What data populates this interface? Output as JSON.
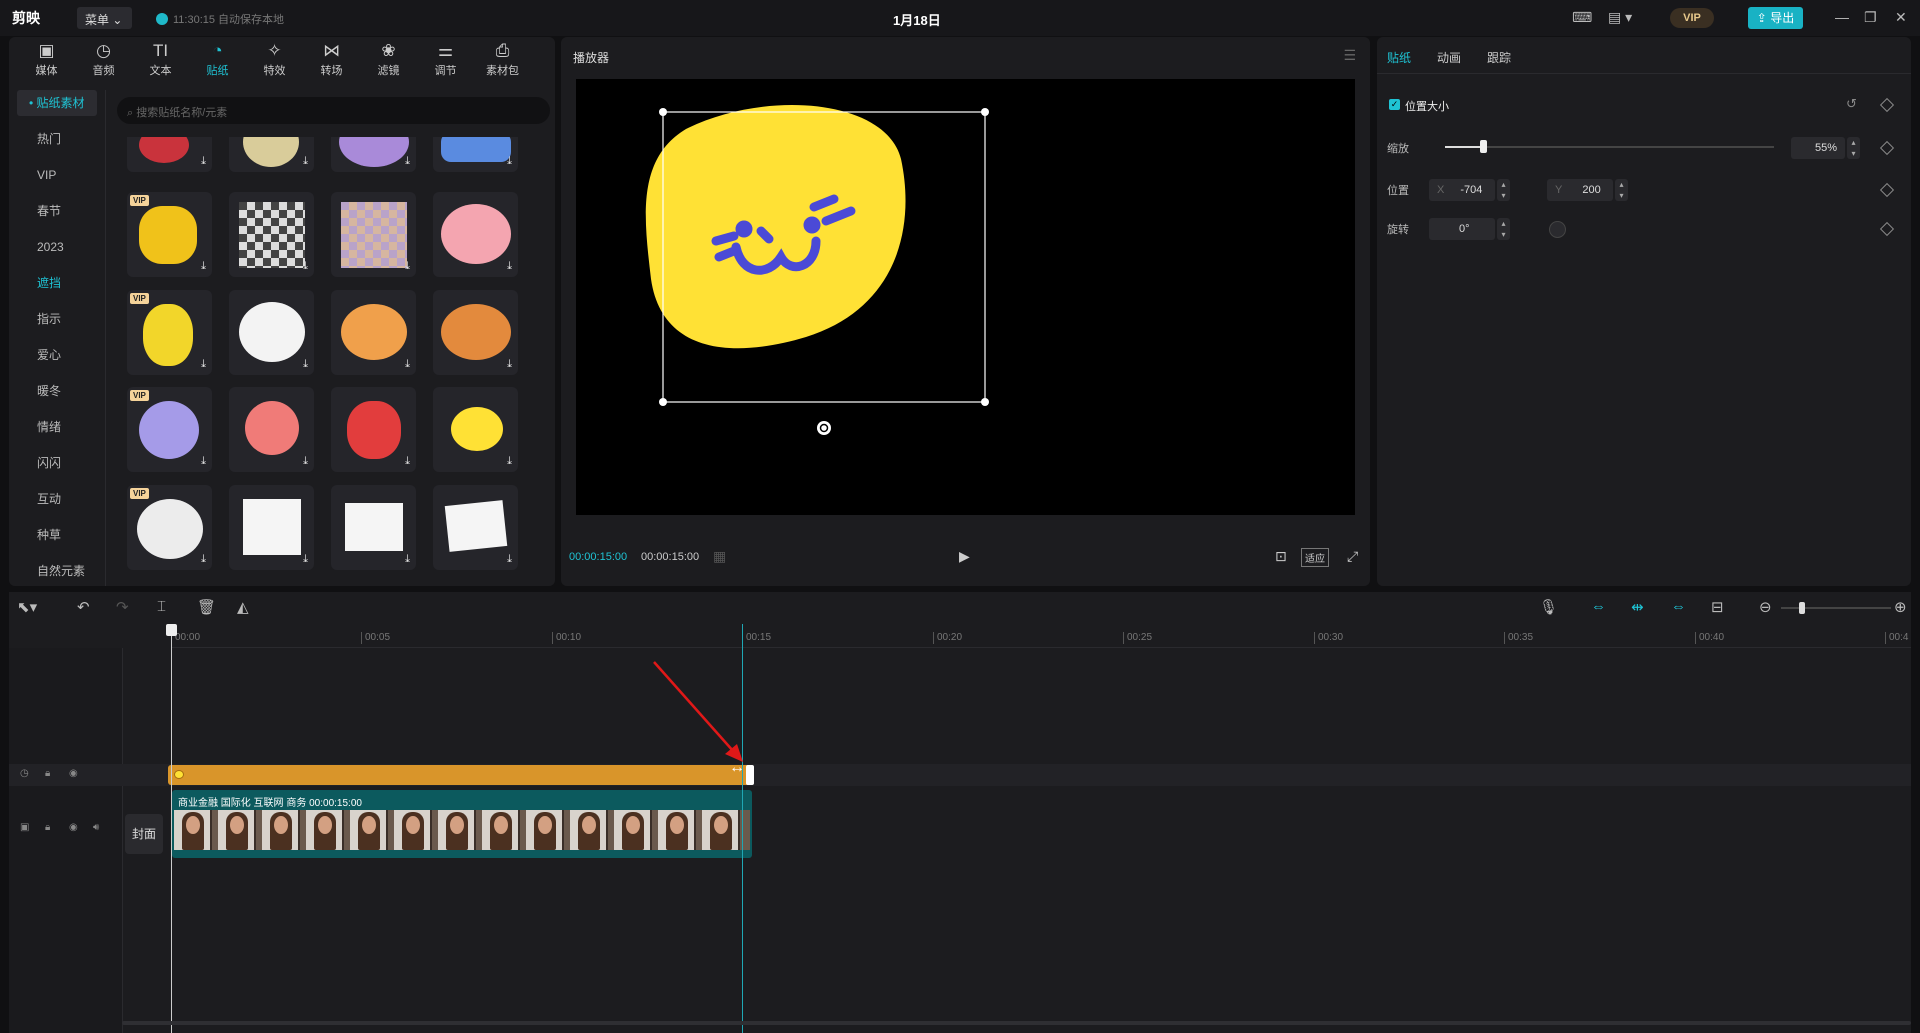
{
  "app": {
    "logo": "剪映",
    "menu": "菜单 ⌄",
    "save_status": "11:30:15 自动保存本地",
    "title": "1月18日",
    "vip": "VIP",
    "export": "导出"
  },
  "media_tabs": [
    {
      "label": "媒体",
      "icon": "▣"
    },
    {
      "label": "音频",
      "icon": "◷"
    },
    {
      "label": "文本",
      "icon": "TI"
    },
    {
      "label": "贴纸",
      "icon": "◔"
    },
    {
      "label": "特效",
      "icon": "✧"
    },
    {
      "label": "转场",
      "icon": "⋈"
    },
    {
      "label": "滤镜",
      "icon": "❀"
    },
    {
      "label": "调节",
      "icon": "⚌"
    },
    {
      "label": "素材包",
      "icon": "⎙"
    }
  ],
  "categories": [
    "• 贴纸素材",
    "热门",
    "VIP",
    "春节",
    "2023",
    "遮挡",
    "指示",
    "爱心",
    "暖冬",
    "情绪",
    "闪闪",
    "互动",
    "种草",
    "自然元素"
  ],
  "search_placeholder": "搜索贴纸名称/元素",
  "badges": {
    "vip": "VIP",
    "download": "⤓"
  },
  "player": {
    "title": "播放器",
    "time_current": "00:00:15:00",
    "time_total": "00:00:15:00",
    "fit": "适应"
  },
  "props": {
    "tabs": [
      "贴纸",
      "动画",
      "跟踪"
    ],
    "section": "位置大小",
    "scale_label": "缩放",
    "scale_value": "55%",
    "position_label": "位置",
    "x_label": "X",
    "x_value": "-704",
    "y_label": "Y",
    "y_value": "200",
    "rotate_label": "旋转",
    "rotate_value": "0°"
  },
  "timeline": {
    "ticks": [
      "00:00",
      "00:05",
      "00:10",
      "00:15",
      "00:20",
      "00:25",
      "00:30",
      "00:35",
      "00:40",
      "00:4"
    ],
    "video_label": "商业金融 国际化 互联网 商务   00:00:15:00",
    "cover": "封面"
  },
  "colors": {
    "accent": "#1fc3d4",
    "sticker_clip": "#d9952a",
    "video_clip": "#0c5a5e",
    "sticker_yellow": "#ffe135",
    "sticker_face": "#4b4ad6"
  }
}
